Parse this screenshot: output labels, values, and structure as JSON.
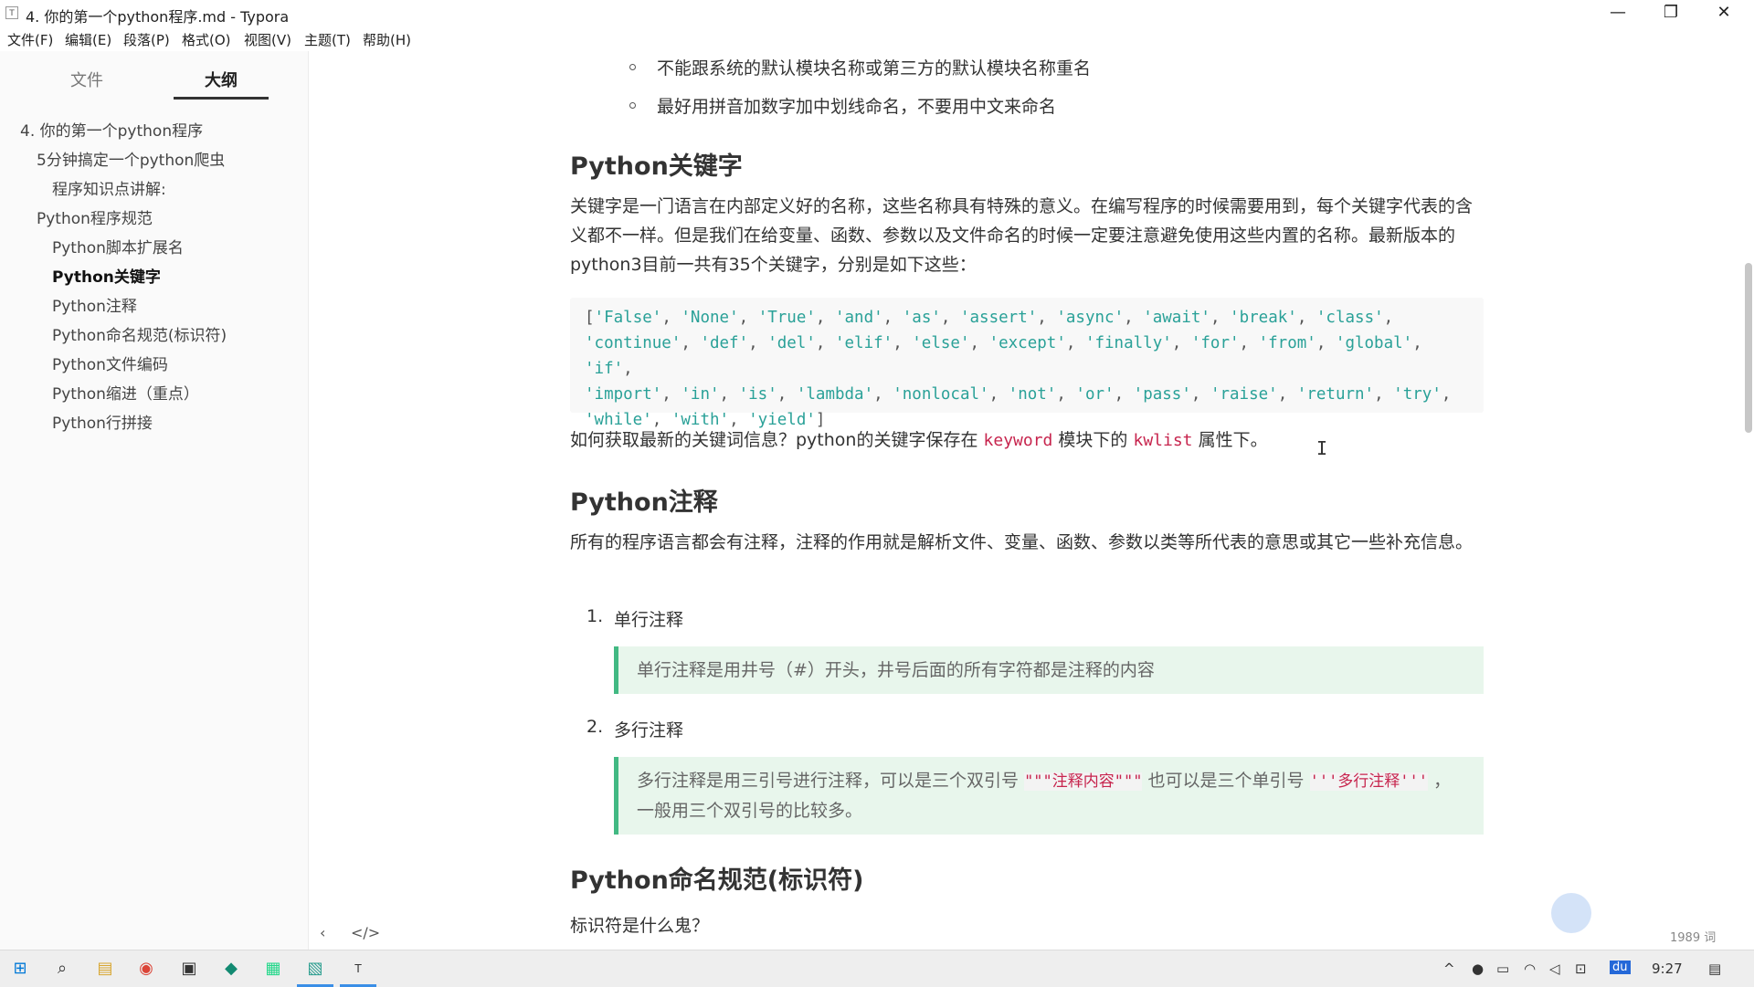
{
  "window": {
    "title": "4. 你的第一个python程序.md - Typora",
    "app_icon": "T",
    "controls": {
      "minimize": "—",
      "restore": "❐",
      "close": "✕"
    }
  },
  "menu": [
    "文件(F)",
    "编辑(E)",
    "段落(P)",
    "格式(O)",
    "视图(V)",
    "主题(T)",
    "帮助(H)"
  ],
  "sidebar": {
    "tabs": [
      {
        "label": "文件"
      },
      {
        "label": "大纲"
      }
    ],
    "outline": [
      {
        "label": "4. 你的第一个python程序"
      },
      {
        "label": "5分钟搞定一个python爬虫"
      },
      {
        "label": "程序知识点讲解:"
      },
      {
        "label": "Python程序规范"
      },
      {
        "label": "Python脚本扩展名"
      },
      {
        "label": "Python关键字"
      },
      {
        "label": "Python注释"
      },
      {
        "label": "Python命名规范(标识符)"
      },
      {
        "label": "Python文件编码"
      },
      {
        "label": "Python缩进（重点）"
      },
      {
        "label": "Python行拼接"
      }
    ]
  },
  "doc": {
    "bullets": [
      "不能跟系统的默认模块名称或第三方的默认模块名称重名",
      "最好用拼音加数字加中划线命名，不要用中文来命名"
    ],
    "h_keywords": "Python关键字",
    "p_keywords": "关键字是一门语言在内部定义好的名称，这些名称具有特殊的意义。在编写程序的时候需要用到，每个关键字代表的含义都不一样。但是我们在给变量、函数、参数以及文件命名的时候一定要注意避免使用这些内置的名称。最新版本的python3目前一共有35个关键字，分别是如下这些：",
    "code_lines": [
      "['False', 'None', 'True', 'and', 'as', 'assert', 'async', 'await', 'break', 'class',",
      "'continue', 'def', 'del', 'elif', 'else', 'except', 'finally', 'for', 'from', 'global', 'if',",
      "'import', 'in', 'is', 'lambda', 'nonlocal', 'not', 'or', 'pass', 'raise', 'return', 'try',",
      "'while', 'with', 'yield']"
    ],
    "p_howto_a": "如何获取最新的关键词信息？python的关键字保存在",
    "p_howto_code1": "keyword",
    "p_howto_b": "模块下的",
    "p_howto_code2": "kwlist",
    "p_howto_c": "属性下。",
    "h_comments": "Python注释",
    "p_comments": "所有的程序语言都会有注释，注释的作用就是解析文件、变量、函数、参数以类等所代表的意思或其它一些补充信息。",
    "ol1_num": "1.",
    "ol1_label": "单行注释",
    "quote1": "单行注释是用井号（#）开头，井号后面的所有字符都是注释的内容",
    "ol2_num": "2.",
    "ol2_label": "多行注释",
    "quote2_a": "多行注释是用三引号进行注释，可以是三个双引号",
    "quote2_code1": "\"\"\"注释内容\"\"\"",
    "quote2_b": "也可以是三个单引号",
    "quote2_code2": "'''多行注释'''",
    "quote2_c": "，一般用三个双引号的比较多。",
    "h_naming": "Python命名规范(标识符)",
    "p_naming": "标识符是什么鬼？"
  },
  "status": {
    "word_count": "1989 词",
    "back": "‹",
    "source": "</>"
  },
  "taskbar": {
    "clock": "9:27",
    "ime": "du"
  }
}
